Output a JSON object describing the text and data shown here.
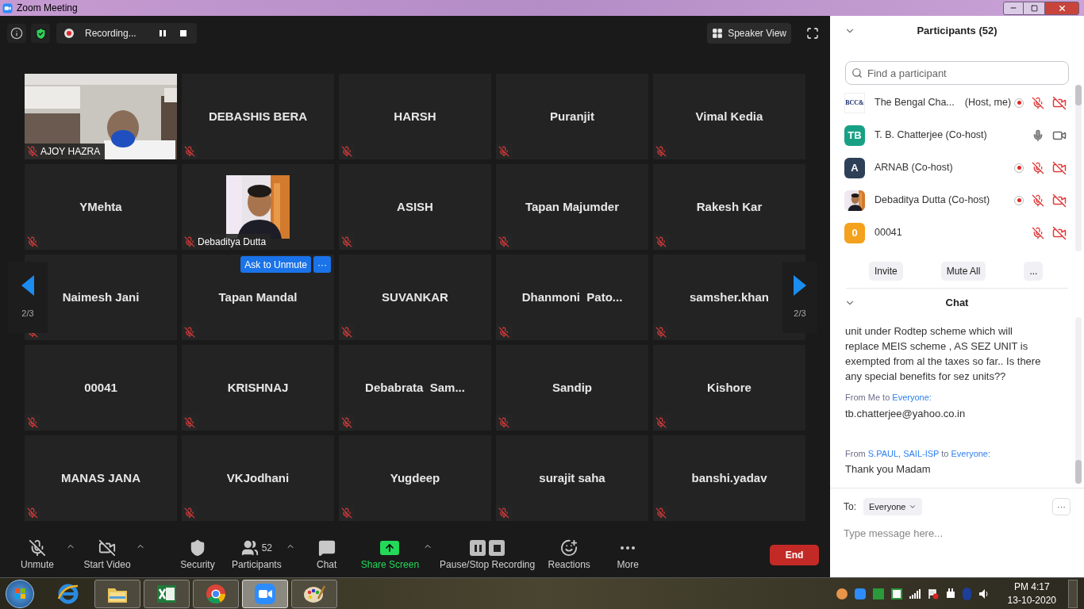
{
  "window": {
    "title": "Zoom Meeting"
  },
  "top_bar": {
    "recording_label": "Recording...",
    "view_button": "Speaker View"
  },
  "tiles": [
    {
      "name": "AJOY HAZRA",
      "kind": "video",
      "muted": true
    },
    {
      "name": "DEBASHIS BERA",
      "kind": "name",
      "muted": true
    },
    {
      "name": "HARSH",
      "kind": "name",
      "muted": true
    },
    {
      "name": "Puranjit",
      "kind": "name",
      "muted": true
    },
    {
      "name": "Vimal Kedia",
      "kind": "name",
      "muted": true
    },
    {
      "name": "YMehta",
      "kind": "name",
      "muted": true
    },
    {
      "name": "Debaditya Dutta",
      "muted": true
    },
    {
      "name": "ASISH",
      "kind": "name",
      "muted": true
    },
    {
      "name": "Tapan Majumder",
      "kind": "name",
      "muted": true
    },
    {
      "name": "Rakesh Kar",
      "kind": "name",
      "muted": true
    },
    {
      "name": "Naimesh Jani",
      "kind": "name",
      "muted": true
    },
    {
      "name": "Tapan Mandal",
      "kind": "name",
      "muted": true,
      "actions": [
        "Ask to Unmute",
        "···"
      ]
    },
    {
      "name": "SUVANKAR",
      "kind": "name",
      "muted": true
    },
    {
      "name": "Dhanmoni  Pato...",
      "kind": "name",
      "muted": true
    },
    {
      "name": "samsher.khan",
      "kind": "name",
      "muted": true
    },
    {
      "name": "00041",
      "kind": "name",
      "muted": true
    },
    {
      "name": "KRISHNAJ",
      "kind": "name",
      "muted": true
    },
    {
      "name": "Debabrata  Sam...",
      "kind": "name",
      "muted": true
    },
    {
      "name": "Sandip",
      "kind": "name",
      "muted": true
    },
    {
      "name": "Kishore",
      "kind": "name",
      "muted": true
    },
    {
      "name": "MANAS JANA",
      "kind": "name",
      "muted": true
    },
    {
      "name": "VKJodhani",
      "kind": "name",
      "muted": true
    },
    {
      "name": "Yugdeep",
      "kind": "name",
      "muted": true
    },
    {
      "name": "surajit saha",
      "kind": "name",
      "muted": true
    },
    {
      "name": "banshi.yadav",
      "kind": "name",
      "muted": true
    }
  ],
  "pager": {
    "left_label": "2/3",
    "right_label": "2/3"
  },
  "toolbar": [
    {
      "kind": "mic_off",
      "label": "Unmute",
      "caret": true
    },
    {
      "kind": "video_off",
      "label": "Start Video",
      "caret": true
    },
    {
      "kind": "shield",
      "label": "Security",
      "caret": false
    },
    {
      "kind": "users",
      "label": "Participants",
      "count": "52",
      "caret": true
    },
    {
      "kind": "chat",
      "label": "Chat",
      "caret": false
    },
    {
      "kind": "share",
      "label": "Share Screen",
      "caret": true,
      "highlighted": true
    },
    {
      "kind": "pause_stop",
      "label": "Pause/Stop Recording",
      "caret": false
    },
    {
      "kind": "reactions",
      "label": "Reactions",
      "caret": false
    },
    {
      "kind": "more",
      "label": "More",
      "caret": false
    }
  ],
  "end_button": "End",
  "participants": {
    "title": "Participants (52)",
    "search_placeholder": "Find a participant",
    "items": [
      {
        "name": "The Bengal Cha...",
        "role": "(Host, me)",
        "avatar": {
          "kind": "logo",
          "text": "BCC&"
        },
        "recording": true,
        "audio_muted": true,
        "video_on": false
      },
      {
        "name": "T. B. Chatterjee (Co-host)",
        "avatar": {
          "kind": "initials",
          "text": "TB",
          "color": "#18a084"
        },
        "recording": false,
        "audio_muted": false,
        "video_on": true
      },
      {
        "name": "ARNAB (Co-host)",
        "avatar": {
          "kind": "initials",
          "text": "A",
          "color": "#2e4058"
        },
        "recording": true,
        "audio_muted": true,
        "video_on": false
      },
      {
        "name": "Debaditya Dutta (Co-host)",
        "recording": true,
        "audio_muted": true,
        "video_on": false
      },
      {
        "name": "00041",
        "avatar": {
          "kind": "initials",
          "text": "0",
          "color": "#f4a11d"
        },
        "recording": false,
        "audio_muted": true,
        "video_on": false
      }
    ],
    "buttons": [
      "Invite",
      "Mute All",
      "..."
    ]
  },
  "chat": {
    "title": "Chat",
    "messages": [
      {
        "body": "unit under Rodtep scheme which will replace MEIS scheme , AS SEZ UNIT is exempted from al the taxes so far.. Is there any special benefits for sez units??"
      },
      {
        "from": "From",
        "sender": "Me",
        "to": "to",
        "recipient": "Everyone:",
        "sender_highlighted": false,
        "body": "tb.chatterjee@yahoo.co.in"
      },
      {
        "from": "From",
        "sender": "S.PAUL, SAIL-ISP",
        "to": "to",
        "recipient": "Everyone:",
        "sender_highlighted": true,
        "body": "Thank you Madam"
      }
    ],
    "to_label": "To:",
    "recipient": "Everyone",
    "more_button": "···",
    "input_placeholder": "Type message here..."
  },
  "taskbar": {
    "apps": [
      {
        "kind": "ie",
        "selected": false
      },
      {
        "kind": "explorer",
        "selected": false
      },
      {
        "kind": "excel",
        "selected": false
      },
      {
        "kind": "chrome",
        "selected": false
      },
      {
        "kind": "zoom",
        "selected": true
      },
      {
        "kind": "paint",
        "selected": false
      }
    ],
    "time": "PM 4:17",
    "date": "13-10-2020"
  }
}
